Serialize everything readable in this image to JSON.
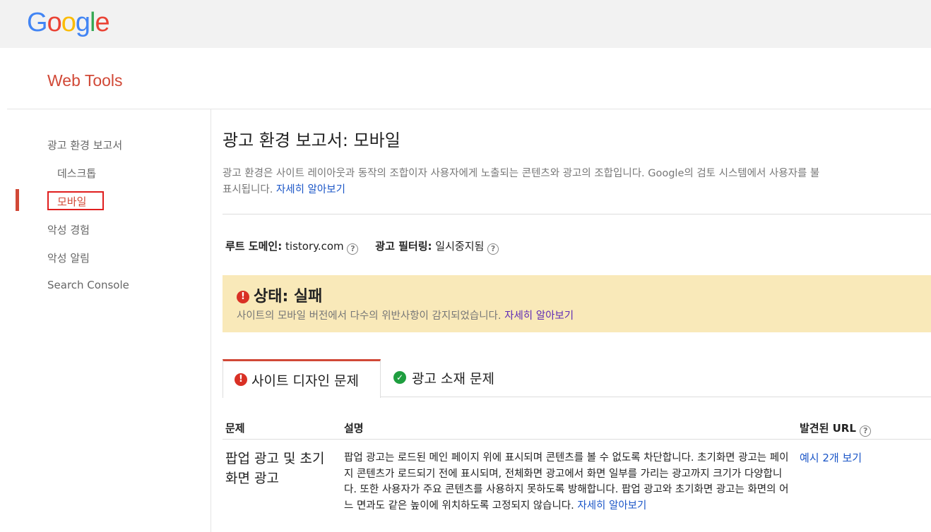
{
  "header": {
    "logo_letters": [
      {
        "ch": "G",
        "color": "#4285F4"
      },
      {
        "ch": "o",
        "color": "#EA4335"
      },
      {
        "ch": "o",
        "color": "#FBBC05"
      },
      {
        "ch": "g",
        "color": "#4285F4"
      },
      {
        "ch": "l",
        "color": "#34A853"
      },
      {
        "ch": "e",
        "color": "#EA4335"
      }
    ],
    "tools_title": "Web Tools"
  },
  "sidebar": {
    "items": [
      {
        "label": "광고 환경 보고서"
      },
      {
        "label": "데스크톱"
      },
      {
        "label": "모바일"
      },
      {
        "label": "악성 경험"
      },
      {
        "label": "악성 알림"
      },
      {
        "label": "Search Console"
      }
    ]
  },
  "main": {
    "title": "광고 환경 보고서: 모바일",
    "intro_line1": "광고 환경은 사이트 레이아웃과 동작의 조합이자 사용자에게 노출되는 콘텐츠와 광고의 조합입니다. Google의 검토 시스템에서 사용자를 불",
    "intro_line2": "표시됩니다.",
    "intro_link": "자세히 알아보기",
    "root_domain_label": "루트 도메인:",
    "root_domain_value": "tistory.com",
    "filter_label": "광고 필터링:",
    "filter_value": "일시중지됨",
    "help_glyph": "?",
    "status": {
      "title": "상태: 실패",
      "description": "사이트의 모바일 버전에서 다수의 위반사항이 감지되었습니다.",
      "link": "자세히 알아보기",
      "icon": "error-icon"
    },
    "tabs": [
      {
        "label": "사이트 디자인 문제",
        "icon": "error-icon",
        "active": true
      },
      {
        "label": "광고 소재 문제",
        "icon": "check-icon",
        "active": false
      }
    ],
    "table": {
      "headers": [
        "문제",
        "설명",
        "발견된 URL"
      ],
      "rows": [
        {
          "problem": "팝업 광고 및 초기화면 광고",
          "description": "팝업 광고는 로드된 메인 페이지 위에 표시되며 콘텐츠를 볼 수 없도록 차단합니다. 초기화면 광고는 페이지 콘텐츠가 로드되기 전에 표시되며, 전체화면 광고에서 화면 일부를 가리는 광고까지 크기가 다양합니다. 또한 사용자가 주요 콘텐츠를 사용하지 못하도록 방해합니다. 팝업 광고와 초기화면 광고는 화면의 어느 면과도 같은 높이에 위치하도록 고정되지 않습니다.",
          "description_link": "자세히 알아보기",
          "url_link": "예시 2개 보기"
        }
      ]
    }
  }
}
